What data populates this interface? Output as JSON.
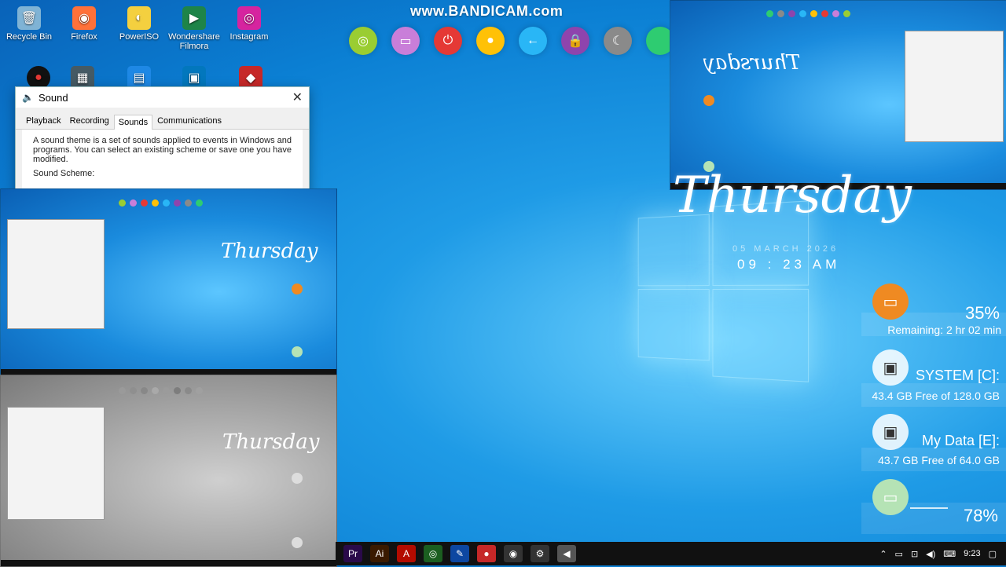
{
  "watermark": "www.BANDICAM.com",
  "orbs": [
    {
      "icon": "headphones-icon",
      "color": "#9acd32",
      "glyph": "◎"
    },
    {
      "icon": "monitor-icon",
      "color": "#c97ed9",
      "glyph": "▭"
    },
    {
      "icon": "power-icon",
      "color": "#e53935",
      "glyph": "⏻"
    },
    {
      "icon": "sun-icon",
      "color": "#ffc107",
      "glyph": "●"
    },
    {
      "icon": "back-arrow-icon",
      "color": "#29b6f6",
      "glyph": "←"
    },
    {
      "icon": "lock-icon",
      "color": "#8e44ad",
      "glyph": "🔒"
    },
    {
      "icon": "moon-icon",
      "color": "#8a8a8a",
      "glyph": "☾"
    },
    {
      "icon": "partial-orb-icon",
      "color": "#2ecc71",
      "glyph": ""
    }
  ],
  "desktop_icons": [
    {
      "name": "recycle-bin",
      "label": "Recycle Bin",
      "color": "#7fb3d5",
      "glyph": "🗑"
    },
    {
      "name": "firefox",
      "label": "Firefox",
      "color": "#ff7139",
      "glyph": "◉"
    },
    {
      "name": "poweriso",
      "label": "PowerISO",
      "color": "#f4d03f",
      "glyph": "◐"
    },
    {
      "name": "wondershare-filmora",
      "label": "Wondershare Filmora",
      "color": "#1e8449",
      "glyph": "▶"
    },
    {
      "name": "instagram",
      "label": "Instagram",
      "color": "#d6249f",
      "glyph": "◎"
    }
  ],
  "sound_dialog": {
    "title": "Sound",
    "tabs": [
      "Playback",
      "Recording",
      "Sounds",
      "Communications"
    ],
    "active_tab": "Sounds",
    "description": "A sound theme is a set of sounds applied to events in Windows and programs. You can select an existing scheme or save one you have modified.",
    "scheme_label": "Sound Scheme:"
  },
  "preview": {
    "word": "Thursday"
  },
  "clock": {
    "day": "Thursday",
    "date": "05 MARCH 2026",
    "time": "09 : 23 AM"
  },
  "widgets": {
    "battery": {
      "percent": "35%",
      "remaining": "Remaining: 2 hr 02 min",
      "color": "#ef8a22"
    },
    "system_drive": {
      "title": "SYSTEM [C]:",
      "free": "43.4 GB Free of 128.0 GB"
    },
    "data_drive": {
      "title": "My Data [E]:",
      "free": "43.7 GB Free of 64.0 GB"
    },
    "ram": {
      "percent": "78%",
      "color": "#b5e3b5"
    }
  },
  "taskbar": {
    "apps": [
      {
        "name": "premiere-icon",
        "color": "#2a0a4a",
        "glyph": "Pr"
      },
      {
        "name": "illustrator-icon",
        "color": "#3a1a00",
        "glyph": "Ai"
      },
      {
        "name": "acrobat-icon",
        "color": "#b30b00",
        "glyph": "A"
      },
      {
        "name": "green-app-icon",
        "color": "#1b5e20",
        "glyph": "◎"
      },
      {
        "name": "vector-app-icon",
        "color": "#0d47a1",
        "glyph": "✎"
      },
      {
        "name": "record-icon",
        "color": "#c62828",
        "glyph": "●"
      },
      {
        "name": "chrome-icon",
        "color": "#333333",
        "glyph": "◉"
      },
      {
        "name": "settings-icon",
        "color": "#333333",
        "glyph": "⚙"
      },
      {
        "name": "speaker-app-icon",
        "color": "#555555",
        "glyph": "◀"
      }
    ],
    "time": "9:23"
  }
}
